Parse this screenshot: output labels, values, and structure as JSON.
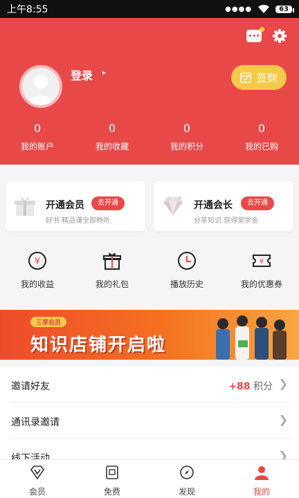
{
  "status_bar": {
    "time": "上午8:55",
    "battery": "63"
  },
  "profile": {
    "login_label": "登录",
    "login_arrow": "▸",
    "checkin_label": "签到"
  },
  "stats": [
    {
      "value": "0",
      "label": "我的账户"
    },
    {
      "value": "0",
      "label": "我的收藏"
    },
    {
      "value": "0",
      "label": "我的积分"
    },
    {
      "value": "0",
      "label": "我的已购"
    }
  ],
  "cards": {
    "vip": {
      "title": "开通会员",
      "button": "去开通",
      "subtitle": "好书 精品课全部畅听"
    },
    "president": {
      "title": "开通会长",
      "button": "去开通",
      "subtitle": "分享知识 获得奖学金"
    }
  },
  "quick_links": [
    {
      "label": "我的收益",
      "icon": "yen-coin-icon"
    },
    {
      "label": "我的礼包",
      "icon": "gift-icon"
    },
    {
      "label": "播放历史",
      "icon": "clock-icon"
    },
    {
      "label": "我的优惠券",
      "icon": "coupon-icon"
    }
  ],
  "banner": {
    "tag": "三享会员",
    "headline": "知识店铺开启啦"
  },
  "list": {
    "invite": {
      "label": "邀请好友",
      "points": "+88",
      "unit": "积分"
    },
    "contacts": {
      "label": "通讯录邀请"
    },
    "offline": {
      "label": "线下活动"
    }
  },
  "tabs": [
    {
      "label": "会员",
      "icon": "diamond-v-icon"
    },
    {
      "label": "免费",
      "icon": "book-icon"
    },
    {
      "label": "发现",
      "icon": "compass-icon"
    },
    {
      "label": "我的",
      "icon": "person-icon"
    }
  ],
  "colors": {
    "primary": "#e94848",
    "gold": "#f7c948",
    "background": "#f5f5f5"
  }
}
